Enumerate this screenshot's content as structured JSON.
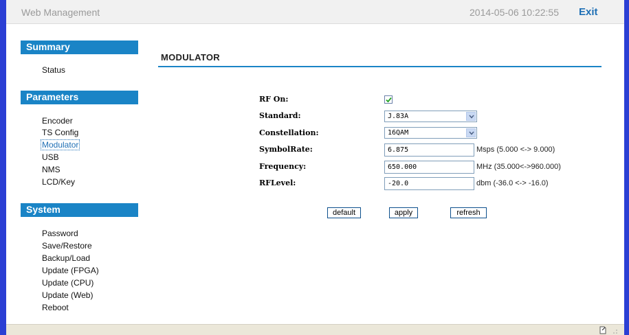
{
  "header": {
    "app_title": "Web Management",
    "datetime": "2014-05-06 10:22:55",
    "exit_label": "Exit"
  },
  "sidebar": {
    "sections": [
      {
        "title": "Summary",
        "items": [
          "Status"
        ]
      },
      {
        "title": "Parameters",
        "items": [
          "Encoder",
          "TS Config",
          "Modulator",
          "USB",
          "NMS",
          "LCD/Key"
        ]
      },
      {
        "title": "System",
        "items": [
          "Password",
          "Save/Restore",
          "Backup/Load",
          "Update (FPGA)",
          "Update (CPU)",
          "Update (Web)",
          "Reboot"
        ]
      }
    ],
    "active_item": "Modulator"
  },
  "main": {
    "title": "MODULATOR",
    "form": {
      "rf_on": {
        "label": "RF On:",
        "checked": true
      },
      "standard": {
        "label": "Standard:",
        "value": "J.83A"
      },
      "constellation": {
        "label": "Constellation:",
        "value": "16QAM"
      },
      "symbol_rate": {
        "label": "SymbolRate:",
        "value": "6.875",
        "unit": "Msps (5.000 <-> 9.000)"
      },
      "frequency": {
        "label": "Frequency:",
        "value": "650.000",
        "unit": "MHz (35.000<->960.000)"
      },
      "rf_level": {
        "label": "RFLevel:",
        "value": "-20.0",
        "unit": "dbm (-36.0 <-> -16.0)"
      }
    },
    "buttons": {
      "default": "default",
      "apply": "apply",
      "refresh": "refresh"
    }
  },
  "colors": {
    "accent": "#1a84c6",
    "frame": "#2b3fd4",
    "header_bg": "#f1f1f1",
    "footer_bg": "#ebe7d9"
  }
}
